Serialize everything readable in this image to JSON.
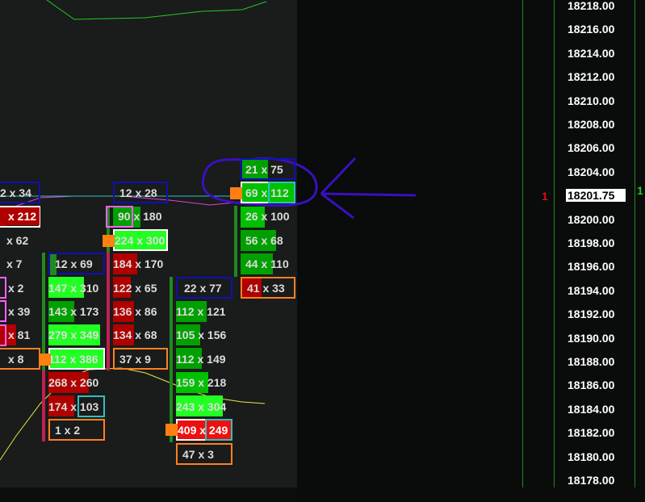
{
  "price_axis": {
    "labels": [
      "18218.00",
      "18216.00",
      "18214.00",
      "18212.00",
      "18210.00",
      "18208.00",
      "18206.00",
      "18204.00",
      "18201.75",
      "18200.00",
      "18198.00",
      "18196.00",
      "18194.00",
      "18192.00",
      "18190.00",
      "18188.00",
      "18186.00",
      "18184.00",
      "18182.00",
      "18180.00",
      "18178.00"
    ],
    "current_price": "18201.75",
    "left_counter": "1",
    "right_counter": "1"
  },
  "colors": {
    "bid_red": "#b00000",
    "ask_green": "#00c000",
    "bright_green": "#22ff22",
    "box_blue": "#1010b0",
    "box_orange": "#ff8020",
    "box_pink": "#ff60ff",
    "box_cyan": "#30c0c0",
    "annotation_purple": "#3a10c0",
    "marker_orange": "#ff7f11"
  },
  "columns": {
    "col0": [
      {
        "text": "2 x 34"
      },
      {
        "text": "x 212"
      },
      {
        "text": "x 62"
      },
      {
        "text": "x 7"
      },
      {
        "text": "x 2"
      },
      {
        "text": "x 39"
      },
      {
        "text": "x 81"
      },
      {
        "text": "x 8"
      }
    ],
    "col1": [
      {
        "text": "12 x 69"
      },
      {
        "text": "147 x 310"
      },
      {
        "text": "143 x 173"
      },
      {
        "text": "279 x 349"
      },
      {
        "text": "112 x 386"
      },
      {
        "text": "268 x 260"
      },
      {
        "text": "174 x 103"
      },
      {
        "text": "1 x 2"
      }
    ],
    "col2": [
      {
        "text": "12 x 28"
      },
      {
        "text": "90 x 180"
      },
      {
        "text": "224 x 300"
      },
      {
        "text": "184 x 170"
      },
      {
        "text": "122 x 65"
      },
      {
        "text": "136 x 86"
      },
      {
        "text": "134 x 68"
      },
      {
        "text": "37 x 9"
      }
    ],
    "col3": [
      {
        "text": "22 x 77"
      },
      {
        "text": "112 x 121"
      },
      {
        "text": "105 x 156"
      },
      {
        "text": "112 x 149"
      },
      {
        "text": "159 x 218"
      },
      {
        "text": "243 x 304"
      },
      {
        "text": "409 x 249"
      },
      {
        "text": "47 x 3"
      }
    ],
    "col4": [
      {
        "text": "21 x 75"
      },
      {
        "text": "69 x 112"
      },
      {
        "text": "26 x 100"
      },
      {
        "text": "56 x 68"
      },
      {
        "text": "44 x 110"
      },
      {
        "text": "41 x 33"
      }
    ]
  }
}
